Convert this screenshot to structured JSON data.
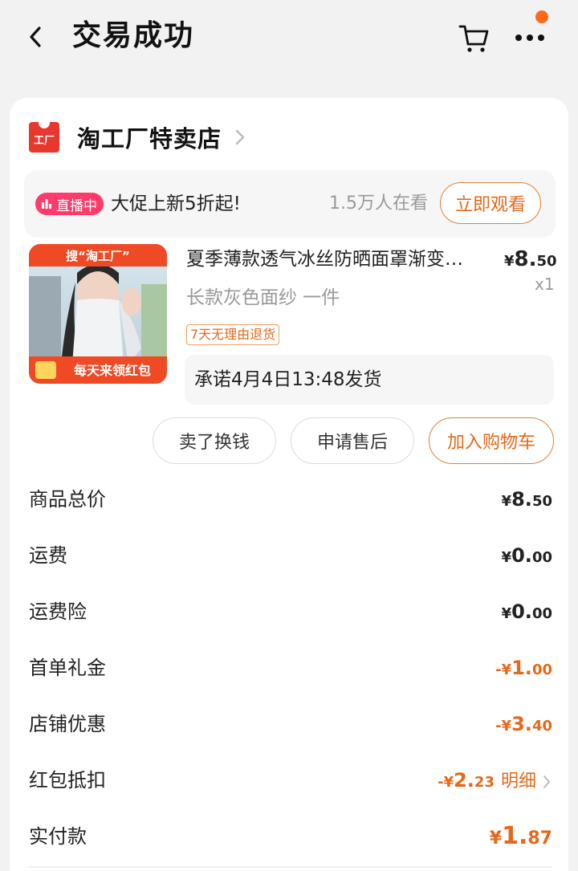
{
  "header": {
    "title": "交易成功"
  },
  "shop": {
    "logo_text": "工厂",
    "name": "淘工厂特卖店"
  },
  "live": {
    "badge": "直播中",
    "promo": "大促上新5折起!",
    "viewers": "1.5万人在看",
    "watch_button": "立即观看"
  },
  "product": {
    "image_top_text": "搜“淘工厂”",
    "image_bottom_text": "每天来领红包",
    "name": "夏季薄款透气冰丝防晒面罩渐变…",
    "price_symbol": "¥",
    "price_int": "8.",
    "price_dec": "50",
    "quantity": "x1",
    "spec": "长款灰色面纱 一件",
    "return_tag": "7天无理由退货",
    "shipping": "承诺4月4日13:48发货"
  },
  "actions": {
    "sell": "卖了换钱",
    "after_sale": "申请售后",
    "add_cart": "加入购物车"
  },
  "summary": {
    "total_label": "商品总价",
    "total_sym": "¥",
    "total_int": "8.",
    "total_dec": "50",
    "shipping_label": "运费",
    "shipping_sym": "¥",
    "shipping_int": "0.",
    "shipping_dec": "00",
    "insurance_label": "运费险",
    "insurance_sym": "¥",
    "insurance_int": "0.",
    "insurance_dec": "00",
    "first_gift_label": "首单礼金",
    "first_gift_sym": "-¥",
    "first_gift_int": "1.",
    "first_gift_dec": "00",
    "shop_discount_label": "店铺优惠",
    "shop_discount_sym": "-¥",
    "shop_discount_int": "3.",
    "shop_discount_dec": "40",
    "redpack_label": "红包抵扣",
    "redpack_sym": "-¥",
    "redpack_int": "2.",
    "redpack_dec": "23",
    "redpack_detail": "明细",
    "paid_label": "实付款",
    "paid_sym": "¥",
    "paid_int": "1.",
    "paid_dec": "87"
  },
  "colors": {
    "accent": "#e4691a",
    "live_badge": "#ff3b6b",
    "shop_logo": "#e8372c",
    "notification_dot": "#ff6a1a"
  },
  "icons": {
    "back": "chevron-left-icon",
    "cart": "cart-icon",
    "more": "more-dots-icon",
    "chevron": "chevron-right-icon",
    "live": "bar-chart-icon"
  }
}
